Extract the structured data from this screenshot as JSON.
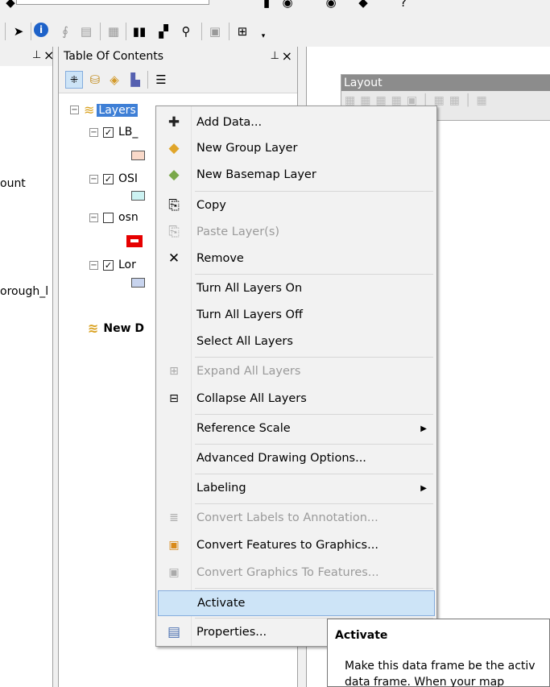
{
  "toc": {
    "title": "Table Of Contents",
    "pin_glyph": "1",
    "close_glyph": "×",
    "root_layer": "Layers",
    "layers": [
      {
        "label": "LB_",
        "checked": true,
        "swatch": "#f9d9c9"
      },
      {
        "label": "OSI",
        "checked": true,
        "swatch": "#ccf2f2"
      },
      {
        "label": "osn",
        "checked": false,
        "swatch": "#e60000"
      },
      {
        "label": "Lor",
        "checked": true,
        "swatch": "#c8d4ee"
      }
    ],
    "new_frame": "New D"
  },
  "left_pane": {
    "text1": "ount",
    "text2": "orough_l"
  },
  "layout": {
    "title": "Layout"
  },
  "context_menu": {
    "items": [
      {
        "label": "Add Data...",
        "icon": "add-data-icon",
        "glyph": "✚",
        "disabled": false
      },
      {
        "label": "New Group Layer",
        "icon": "group-layer-icon",
        "glyph": "◆",
        "disabled": false
      },
      {
        "label": "New Basemap Layer",
        "icon": "basemap-layer-icon",
        "glyph": "◆",
        "disabled": false
      },
      {
        "label": "Copy",
        "icon": "copy-icon",
        "glyph": "⎘",
        "disabled": false
      },
      {
        "label": "Paste Layer(s)",
        "icon": "paste-icon",
        "glyph": "⎘",
        "disabled": true
      },
      {
        "label": "Remove",
        "icon": "remove-icon",
        "glyph": "✕",
        "disabled": false
      },
      {
        "label": "Turn All Layers On",
        "icon": "",
        "glyph": "",
        "disabled": false
      },
      {
        "label": "Turn All Layers Off",
        "icon": "",
        "glyph": "",
        "disabled": false
      },
      {
        "label": "Select All Layers",
        "icon": "",
        "glyph": "",
        "disabled": false
      },
      {
        "label": "Expand All Layers",
        "icon": "expand-icon",
        "glyph": "⊞",
        "disabled": true
      },
      {
        "label": "Collapse All Layers",
        "icon": "collapse-icon",
        "glyph": "⊟",
        "disabled": false
      },
      {
        "label": "Reference Scale",
        "icon": "",
        "glyph": "",
        "disabled": false,
        "submenu": true
      },
      {
        "label": "Advanced Drawing Options...",
        "icon": "",
        "glyph": "",
        "disabled": false
      },
      {
        "label": "Labeling",
        "icon": "",
        "glyph": "",
        "disabled": false,
        "submenu": true
      },
      {
        "label": "Convert Labels to Annotation...",
        "icon": "convert-labels-icon",
        "glyph": "≡",
        "disabled": true
      },
      {
        "label": "Convert Features to Graphics...",
        "icon": "convert-features-icon",
        "glyph": "▣",
        "disabled": false
      },
      {
        "label": "Convert Graphics To Features...",
        "icon": "convert-graphics-icon",
        "glyph": "▣",
        "disabled": true
      },
      {
        "label": "Activate",
        "icon": "",
        "glyph": "",
        "disabled": false,
        "highlighted": true
      },
      {
        "label": "Properties...",
        "icon": "properties-icon",
        "glyph": "▤",
        "disabled": false
      }
    ],
    "submenu_arrow": "▶"
  },
  "tooltip": {
    "title": "Activate",
    "line1": "Make this data frame be the activ",
    "line2": "data frame. When your map"
  }
}
